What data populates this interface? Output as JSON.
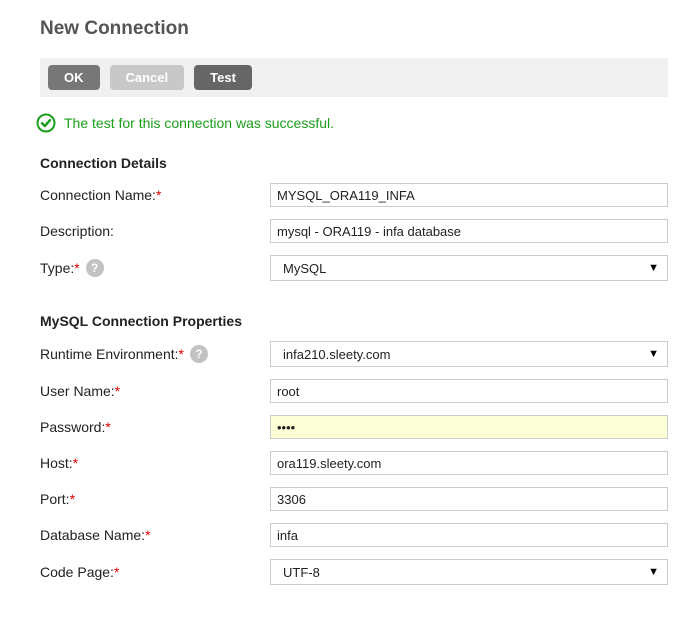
{
  "title": "New Connection",
  "buttons": {
    "ok": "OK",
    "cancel": "Cancel",
    "test": "Test"
  },
  "status": {
    "message": "The test for this connection was successful."
  },
  "sections": {
    "details": "Connection Details",
    "mysql_props": "MySQL Connection Properties"
  },
  "labels": {
    "connection_name": "Connection Name:",
    "description": "Description:",
    "type": "Type:",
    "runtime_env": "Runtime Environment:",
    "user_name": "User Name:",
    "password": "Password:",
    "host": "Host:",
    "port": "Port:",
    "database_name": "Database Name:",
    "code_page": "Code Page:"
  },
  "values": {
    "connection_name": "MYSQL_ORA119_INFA",
    "description": "mysql - ORA119 - infa database",
    "type": "MySQL",
    "runtime_env": "infa210.sleety.com",
    "user_name": "root",
    "password": "••••",
    "host": "ora119.sleety.com",
    "port": "3306",
    "database_name": "infa",
    "code_page": "UTF-8"
  }
}
